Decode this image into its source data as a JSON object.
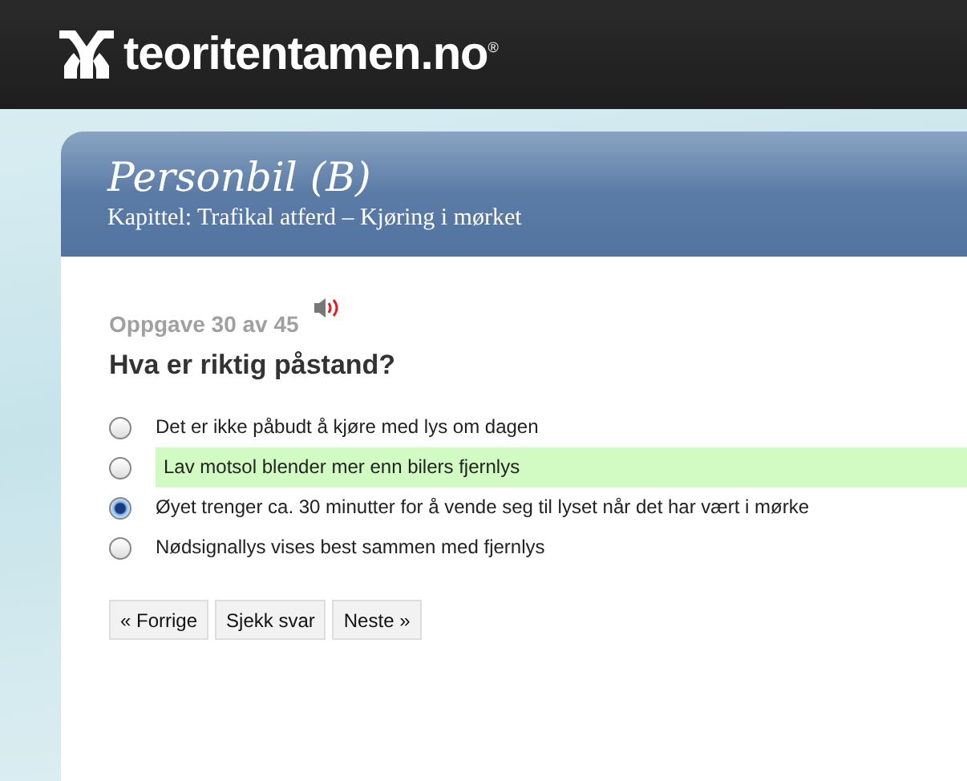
{
  "site": {
    "name": "teoritentamen.no",
    "mark": "®"
  },
  "panel": {
    "title": "Personbil (B)",
    "subtitle": "Kapittel: Trafikal atferd – Kjøring i mørket"
  },
  "question": {
    "counter": "Oppgave 30 av 45",
    "text": "Hva er riktig påstand?"
  },
  "options": [
    {
      "label": "Det er ikke påbudt å kjøre med lys om dagen",
      "selected": false,
      "correct": false
    },
    {
      "label": "Lav motsol blender mer enn bilers fjernlys",
      "selected": false,
      "correct": true
    },
    {
      "label": "Øyet trenger ca. 30 minutter for å vende seg til lyset når det har vært i mørke",
      "selected": true,
      "correct": false
    },
    {
      "label": "Nødsignallys vises best sammen med fjernlys",
      "selected": false,
      "correct": false
    }
  ],
  "buttons": [
    "« Forrige",
    "Sjekk svar",
    "Neste »"
  ]
}
